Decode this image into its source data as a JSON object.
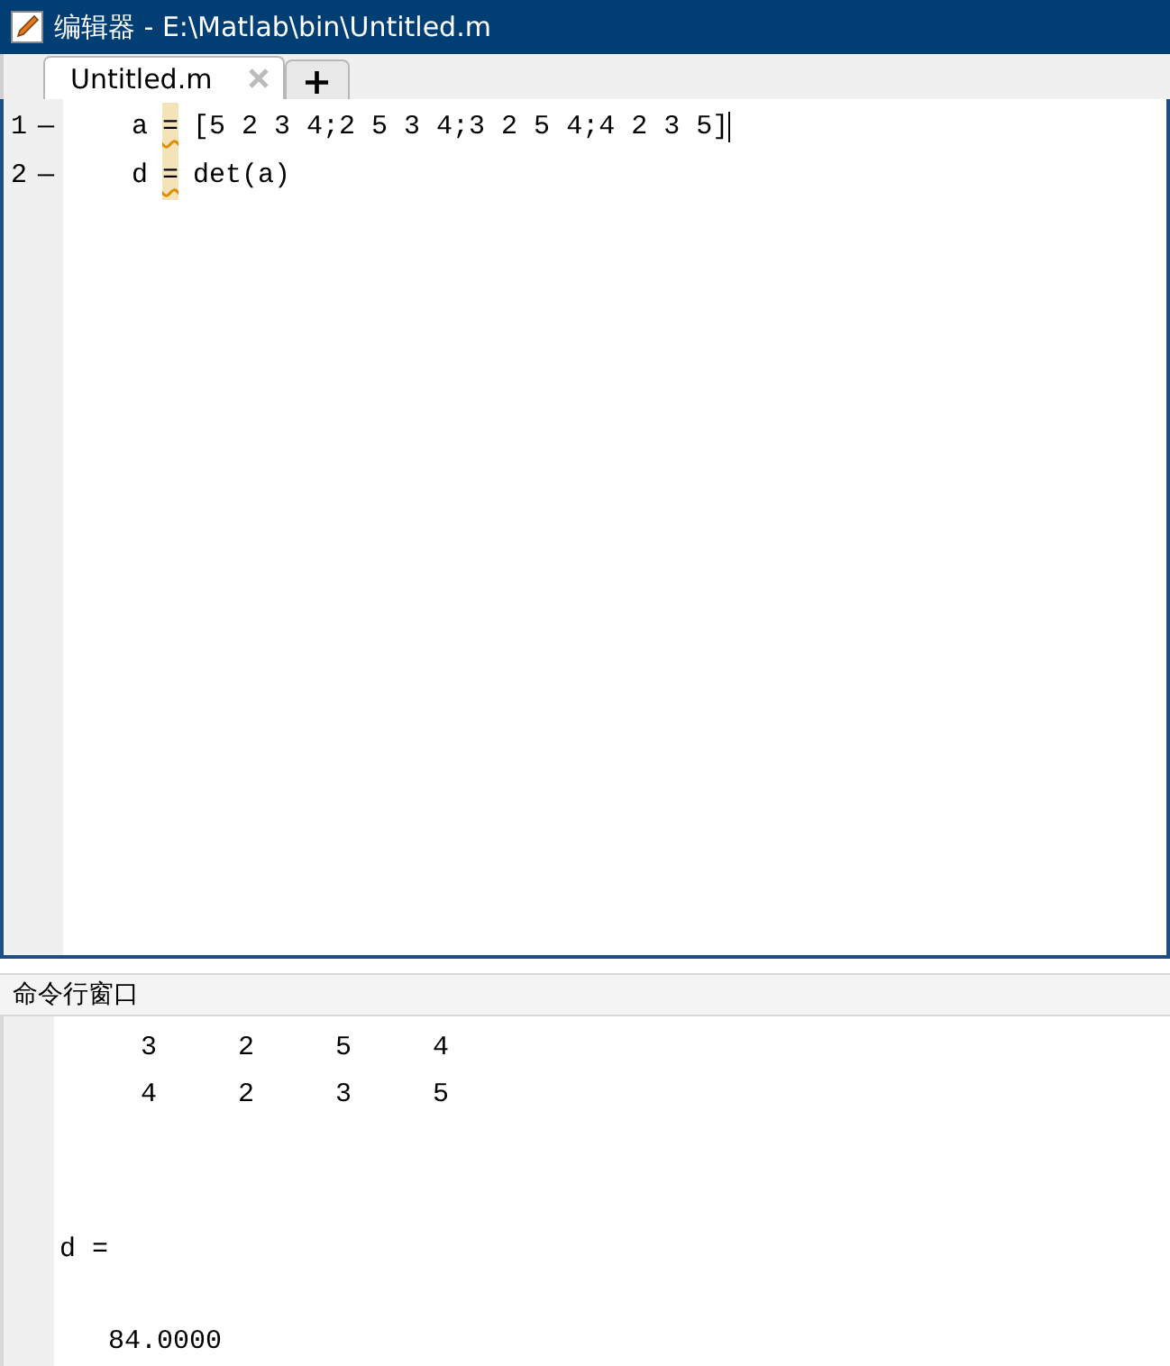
{
  "window": {
    "title": "编辑器 - E:\\Matlab\\bin\\Untitled.m"
  },
  "tabs": [
    {
      "label": "Untitled.m",
      "selected": true
    }
  ],
  "new_tab": "+",
  "editor": {
    "lines": [
      {
        "number": "1",
        "marker": "—",
        "variable": "a",
        "operator": "=",
        "expression": "[5 2 3 4;2 5 3 4;3 2 5 4;4 2 3 5]"
      },
      {
        "number": "2",
        "marker": "—",
        "variable": "d",
        "operator": "=",
        "expression": "det(a)"
      }
    ]
  },
  "command_window": {
    "title": "命令行窗口",
    "matrix_rows": [
      [
        "3",
        "2",
        "5",
        "4"
      ],
      [
        "4",
        "2",
        "3",
        "5"
      ]
    ],
    "result_label": "d =",
    "result_value": "84.0000"
  }
}
